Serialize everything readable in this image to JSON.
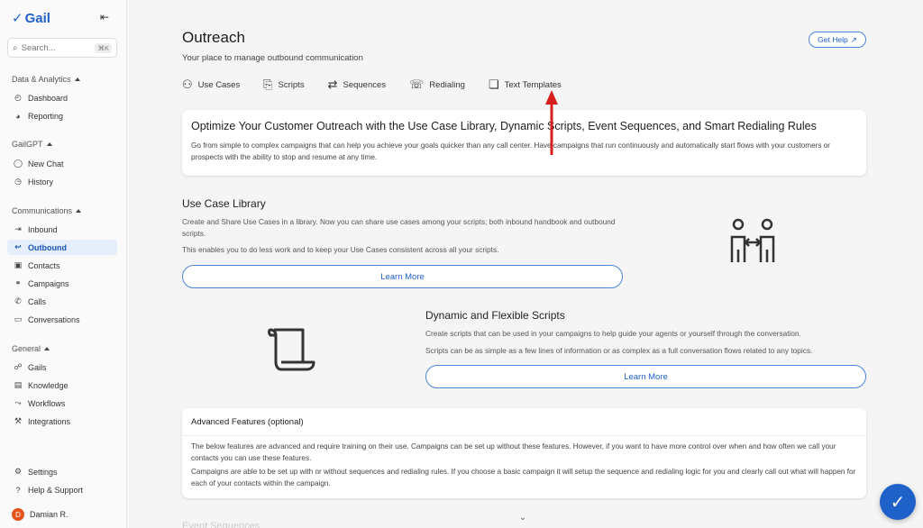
{
  "brand": {
    "name": "Gail"
  },
  "sidebar": {
    "search_placeholder": "Search...",
    "search_shortcut": "⌘K",
    "sections": [
      {
        "label": "Data & Analytics",
        "items": [
          {
            "label": "Dashboard",
            "icon": "clock-icon"
          },
          {
            "label": "Reporting",
            "icon": "chart-icon"
          }
        ]
      },
      {
        "label": "GailGPT",
        "items": [
          {
            "label": "New Chat",
            "icon": "chat-icon"
          },
          {
            "label": "History",
            "icon": "history-icon"
          }
        ]
      },
      {
        "label": "Communications",
        "items": [
          {
            "label": "Inbound",
            "icon": "inbound-icon"
          },
          {
            "label": "Outbound",
            "icon": "outbound-icon"
          },
          {
            "label": "Contacts",
            "icon": "contacts-icon"
          },
          {
            "label": "Campaigns",
            "icon": "campaigns-icon"
          },
          {
            "label": "Calls",
            "icon": "phone-icon"
          },
          {
            "label": "Conversations",
            "icon": "conversations-icon"
          }
        ]
      },
      {
        "label": "General",
        "items": [
          {
            "label": "Gails",
            "icon": "people-icon"
          },
          {
            "label": "Knowledge",
            "icon": "book-icon"
          },
          {
            "label": "Workflows",
            "icon": "workflow-icon"
          },
          {
            "label": "Integrations",
            "icon": "wrench-icon"
          }
        ]
      }
    ],
    "footer": {
      "settings": "Settings",
      "help": "Help & Support"
    },
    "user": {
      "initial": "D",
      "name": "Damian R."
    }
  },
  "page": {
    "title": "Outreach",
    "subtitle": "Your place to manage outbound communication",
    "help_button": "Get Help",
    "tabs": [
      "Use Cases",
      "Scripts",
      "Sequences",
      "Redialing",
      "Text Templates"
    ]
  },
  "hero": {
    "title": "Optimize Your Customer Outreach with the Use Case Library, Dynamic Scripts, Event Sequences, and Smart Redialing Rules",
    "body": "Go from simple to complex campaigns that can help you achieve your goals quicker than any call center. Have campaigns that run continuously and automatically start flows with your customers or prospects with the ability to stop and resume at any time."
  },
  "use_case": {
    "title": "Use Case Library",
    "body1": "Create and Share Use Cases in a library. Now you can share use cases among your scripts; both inbound handbook and outbound scripts.",
    "body2": "This enables you to do less work and to keep your Use Cases consistent across all your scripts.",
    "button": "Learn More"
  },
  "scripts": {
    "title": "Dynamic and Flexible Scripts",
    "body1": "Create scripts that can be used in your campaigns to help guide your agents or yourself through the conversation.",
    "body2": "Scripts can be as simple as a few lines of information or as complex as a full conversation flows related to any topics.",
    "button": "Learn More"
  },
  "advanced": {
    "title": "Advanced Features (optional)",
    "body1": "The below features are advanced and require training on their use. Campaigns can be set up without these features. However, if you want to have more control over when and how often we call your contacts you can use these features.",
    "body2": "Campaigns are able to be set up with or without sequences and redialing rules. If you choose a basic campaign it will setup the sequence and redialing logic for you and clearly call out what will happen for each of your contacts within the campaign."
  },
  "next_section": "Event Sequences",
  "colors": {
    "accent": "#1e62c9",
    "annotation_arrow": "#d81e1e"
  }
}
